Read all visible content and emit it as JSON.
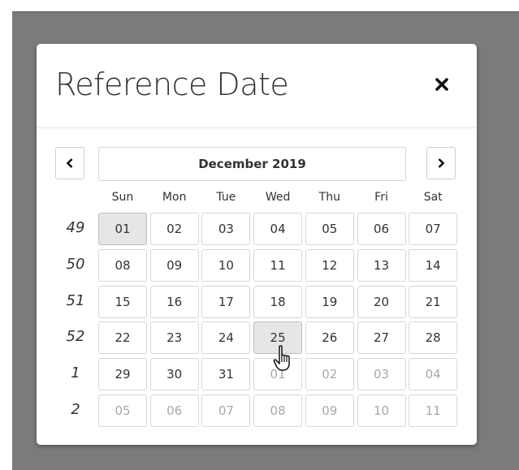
{
  "modal": {
    "title": "Reference Date",
    "close_icon": "close-icon"
  },
  "calendar": {
    "month_label": "December 2019",
    "prev_icon": "chevron-left-icon",
    "next_icon": "chevron-right-icon",
    "weekdays": [
      "Sun",
      "Mon",
      "Tue",
      "Wed",
      "Thu",
      "Fri",
      "Sat"
    ],
    "weeks": [
      {
        "num": "49",
        "days": [
          "01",
          "02",
          "03",
          "04",
          "05",
          "06",
          "07"
        ]
      },
      {
        "num": "50",
        "days": [
          "08",
          "09",
          "10",
          "11",
          "12",
          "13",
          "14"
        ]
      },
      {
        "num": "51",
        "days": [
          "15",
          "16",
          "17",
          "18",
          "19",
          "20",
          "21"
        ]
      },
      {
        "num": "52",
        "days": [
          "22",
          "23",
          "24",
          "25",
          "26",
          "27",
          "28"
        ]
      },
      {
        "num": "1",
        "days": [
          "29",
          "30",
          "31",
          "01",
          "02",
          "03",
          "04"
        ]
      },
      {
        "num": "2",
        "days": [
          "05",
          "06",
          "07",
          "08",
          "09",
          "10",
          "11"
        ]
      }
    ],
    "selected_day": "01",
    "hovered_day": "25"
  },
  "colors": {
    "backdrop": "#7b7b7b",
    "selected_bg": "#e6e6e6",
    "muted_text": "#a8a8a8"
  }
}
